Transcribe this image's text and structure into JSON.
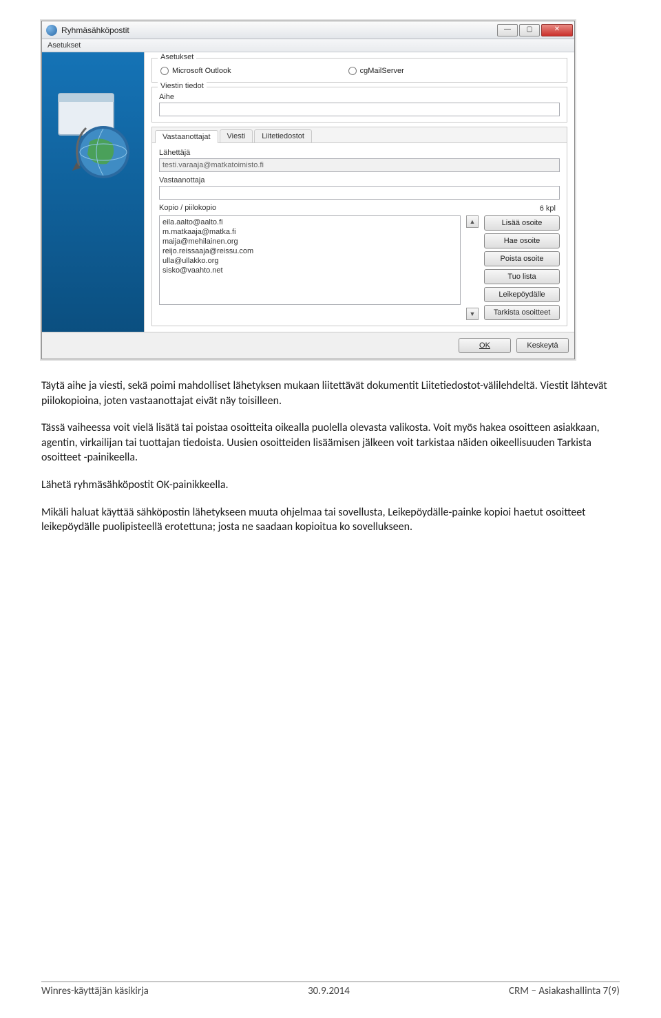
{
  "screenshot": {
    "title": "Ryhmäsähköpostit",
    "menu": "Asetukset",
    "settings": {
      "legend": "Asetukset",
      "radio1": "Microsoft Outlook",
      "radio2": "cgMailServer"
    },
    "viestin": {
      "legend": "Viestin tiedot",
      "aihe_label": "Aihe"
    },
    "tabs": {
      "t1": "Vastaanottajat",
      "t2": "Viesti",
      "t3": "Liitetiedostot"
    },
    "sender": {
      "label": "Lähettäjä",
      "value": "testi.varaaja@matkatoimisto.fi"
    },
    "recipient_label": "Vastaanottaja",
    "kopio": {
      "label": "Kopio / piilokopio",
      "count": "6 kpl",
      "list": [
        "eila.aalto@aalto.fi",
        "m.matkaaja@matka.fi",
        "maija@mehilainen.org",
        "reijo.reissaaja@reissu.com",
        "ulla@ullakko.org",
        "sisko@vaahto.net"
      ]
    },
    "buttons": {
      "add": "Lisää osoite",
      "get": "Hae osoite",
      "del": "Poista osoite",
      "import": "Tuo lista",
      "clipboard": "Leikepöydälle",
      "check": "Tarkista osoitteet"
    },
    "ok": "OK",
    "cancel": "Keskeytä"
  },
  "body": {
    "p1": "Täytä aihe ja viesti, sekä poimi mahdolliset lähetyksen mukaan liitettävät dokumentit Liitetiedostot-välilehdeltä. Viestit lähtevät piilokopioina, joten vastaanottajat eivät näy toisilleen.",
    "p2": "Tässä vaiheessa voit vielä lisätä tai poistaa osoitteita oikealla puolella olevasta valikosta. Voit myös hakea osoitteen asiakkaan, agentin, virkailijan tai tuottajan tiedoista. Uusien osoitteiden lisäämisen jälkeen voit tarkistaa näiden oikeellisuuden Tarkista osoitteet -painikeella.",
    "p3": "Lähetä ryhmäsähköpostit OK-painikkeella.",
    "p4": "Mikäli haluat käyttää sähköpostin lähetykseen muuta ohjelmaa tai sovellusta, Leikepöydälle-painke kopioi haetut osoitteet leikepöydälle puolipisteellä erotettuna; josta ne saadaan kopioitua ko sovellukseen."
  },
  "footer": {
    "left": "Winres-käyttäjän käsikirja",
    "center": "30.9.2014",
    "right": "CRM – Asiakashallinta  7(9)"
  }
}
